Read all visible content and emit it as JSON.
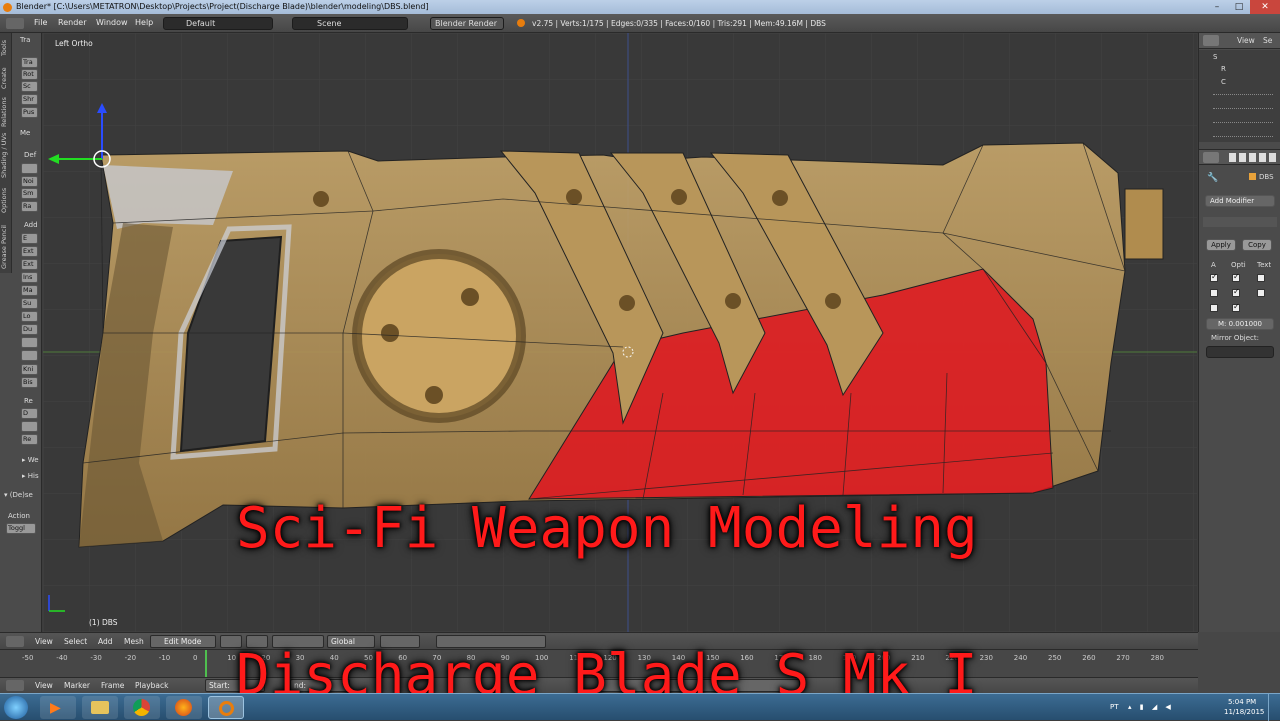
{
  "window": {
    "title": "Blender* [C:\\Users\\METATRON\\Desktop\\Projects\\Project(Discharge Blade)\\blender\\modeling\\DBS.blend]"
  },
  "menubar": {
    "file": "File",
    "render": "Render",
    "window": "Window",
    "help": "Help",
    "screen_layout": "Default",
    "scene": "Scene",
    "render_engine": "Blender Render",
    "stats": "v2.75 | Verts:1/175 | Edges:0/335 | Faces:0/160 | Tris:291 | Mem:49.16M | DBS"
  },
  "toolshelf": {
    "tabs": [
      "Tools",
      "Create",
      "Relations",
      "Shading / UVs",
      "Options",
      "Grease Pencil"
    ],
    "section_transform": "Tra",
    "buttons_transform": [
      "Tra",
      "Rot",
      "Sc",
      "Shr",
      "Pus"
    ],
    "section_mesh": "Me",
    "label_deform": "Def",
    "buttons_mesh": [
      "Noi",
      "Sm",
      "Ra"
    ],
    "label_add": "Add",
    "buttons_add": [
      "E",
      "Ext",
      "Ext",
      "Ins",
      "Ma",
      "Su",
      "Lo",
      "Du"
    ],
    "buttons_more": [
      "Kni",
      "Bis"
    ],
    "label_remove": "Re",
    "buttons_remove": [
      "D",
      "Re"
    ],
    "section_weights": "We",
    "section_history": "His",
    "operator_panel": "(De)se",
    "action_label": "Action",
    "action_value": "Toggl"
  },
  "viewport": {
    "view_name": "Left Ortho",
    "object_label": "(1) DBS"
  },
  "right_panel": {
    "view": "View",
    "search": "Se",
    "outliner_items": [
      "S",
      "R",
      "C",
      "",
      "",
      "",
      ""
    ],
    "object_name": "DBS",
    "add_modifier": "Add Modifier",
    "apply": "Apply",
    "copy": "Copy",
    "axis_header": [
      "A",
      "Opti",
      "Text"
    ],
    "merge_value": "M: 0.001000",
    "mirror_object_label": "Mirror Object:"
  },
  "viewport_header": {
    "view": "View",
    "select": "Select",
    "add": "Add",
    "mesh": "Mesh",
    "mode": "Edit Mode",
    "orientation": "Global"
  },
  "timeline": {
    "ticks": [
      "-50",
      "-40",
      "-30",
      "-20",
      "-10",
      "0",
      "10",
      "20",
      "30",
      "40",
      "50",
      "60",
      "70",
      "80",
      "90",
      "100",
      "110",
      "120",
      "130",
      "140",
      "150",
      "160",
      "170",
      "180",
      "190",
      "200",
      "210",
      "220",
      "230",
      "240",
      "250",
      "260",
      "270",
      "280"
    ],
    "view": "View",
    "marker": "Marker",
    "frame": "Frame",
    "playback": "Playback",
    "start": "Start:",
    "end": "nd:"
  },
  "overlay": {
    "title_line1": "Sci-Fi Weapon Modeling",
    "title_line2": "Discharge Blade S Mk I"
  },
  "taskbar": {
    "language": "PT",
    "time": "5:04 PM",
    "date": "11/18/2015"
  },
  "colors": {
    "selection_red": "#e0141e",
    "texture_tan": "#b8965a",
    "overlay_text": "#ff1a1a",
    "blender_orange": "#e87d0d"
  }
}
